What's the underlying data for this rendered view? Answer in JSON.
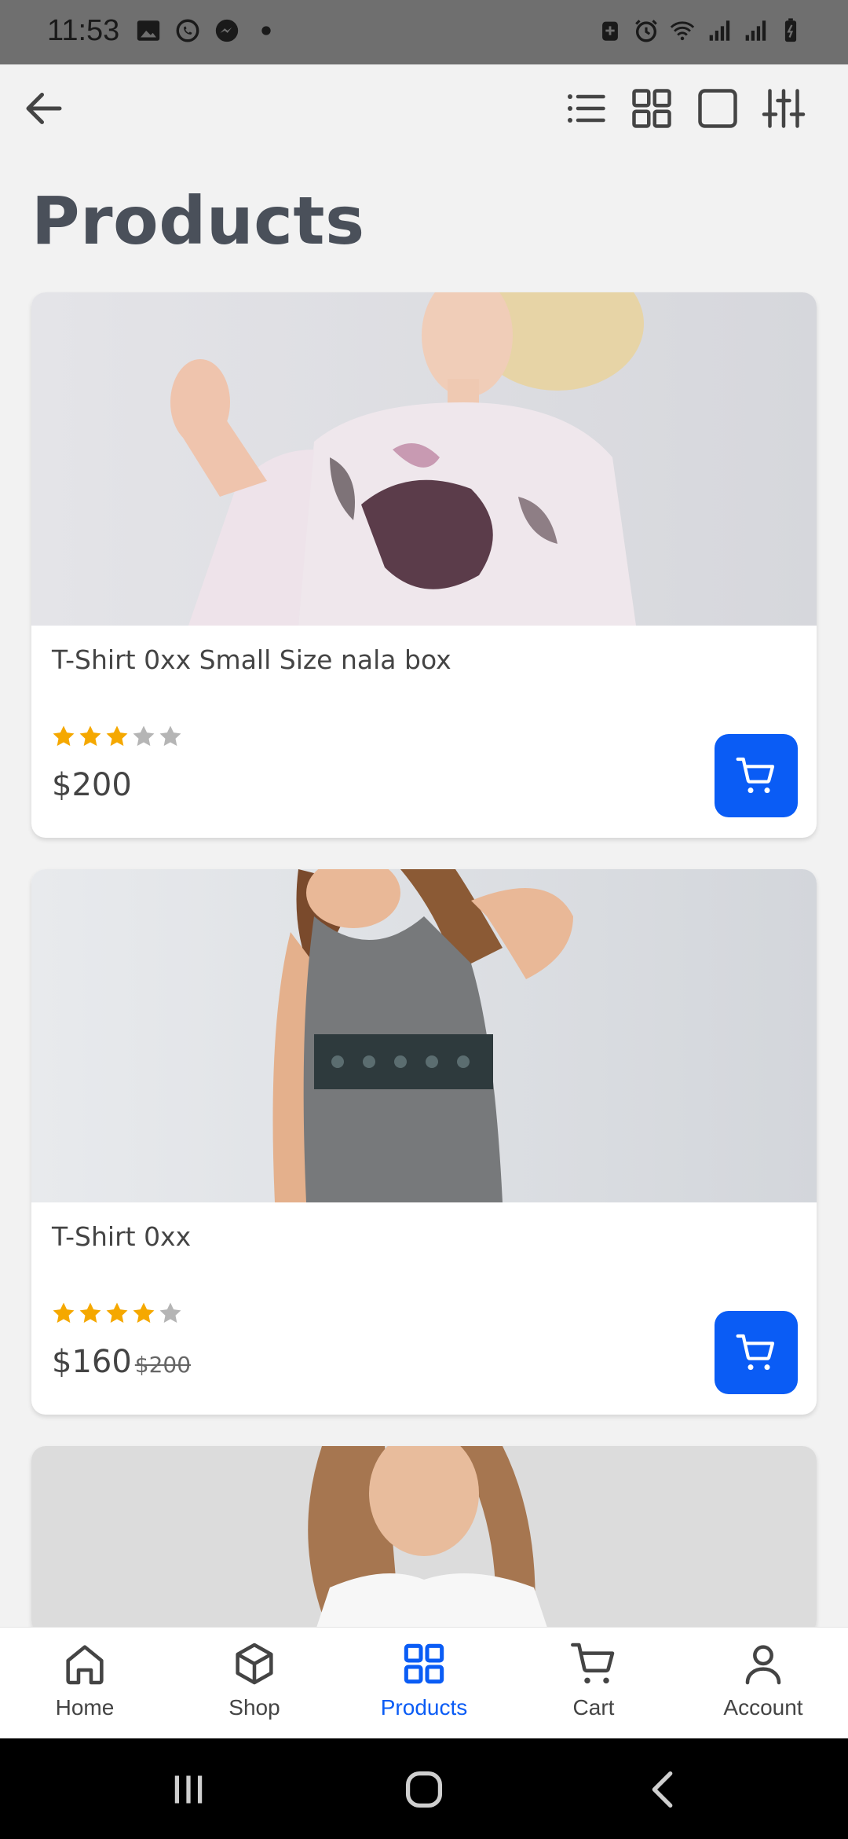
{
  "status_bar": {
    "time": "11:53",
    "left_icons": [
      "gallery-icon",
      "whatsapp-icon",
      "messenger-icon",
      "dot-icon"
    ],
    "right_icons": [
      "battery-saver-icon",
      "alarm-icon",
      "wifi-icon",
      "signal-icon",
      "signal-icon",
      "battery-icon"
    ]
  },
  "page": {
    "title": "Products"
  },
  "products": [
    {
      "name": "T-Shirt 0xx Small Size nala box",
      "price": "$200",
      "old_price": "",
      "rating": 3,
      "max_rating": 5
    },
    {
      "name": "T-Shirt 0xx",
      "price": "$160",
      "old_price": "$200",
      "rating": 4,
      "max_rating": 5
    }
  ],
  "bottom_nav": {
    "items": [
      {
        "label": "Home",
        "icon": "home-icon",
        "active": false
      },
      {
        "label": "Shop",
        "icon": "box-icon",
        "active": false
      },
      {
        "label": "Products",
        "icon": "grid-icon",
        "active": true
      },
      {
        "label": "Cart",
        "icon": "cart-icon",
        "active": false
      },
      {
        "label": "Account",
        "icon": "user-icon",
        "active": false
      }
    ]
  },
  "colors": {
    "accent": "#0a5cf5",
    "star_filled": "#f5a800",
    "star_empty": "#b5b5b5",
    "title": "#4a505a"
  }
}
